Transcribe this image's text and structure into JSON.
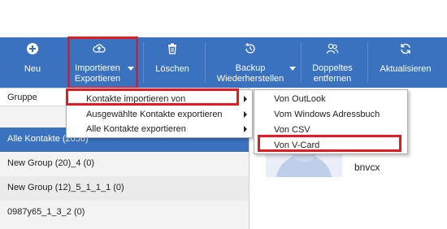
{
  "toolbar": {
    "buttons": [
      {
        "id": "neu",
        "label": "Neu",
        "icon": "plus-circle-icon"
      },
      {
        "id": "import",
        "label_line1": "Importieren",
        "label_line2": "Exportieren",
        "icon": "cloud-upload-icon"
      },
      {
        "id": "delete",
        "label": "Löschen",
        "icon": "trash-icon"
      },
      {
        "id": "backup",
        "label_line1": "Backup",
        "label_line2": "Wiederherstellen",
        "icon": "history-icon"
      },
      {
        "id": "dup",
        "label_line1": "Doppeltes",
        "label_line2": "entfernen",
        "icon": "users-icon"
      },
      {
        "id": "refresh",
        "label": "Aktualisieren",
        "icon": "refresh-icon"
      }
    ]
  },
  "sidebar": {
    "header": "Gruppe",
    "groups": [
      {
        "label": "Alle Kontakte  (2056)",
        "selected": true
      },
      {
        "label": "New Group (20)_4  (0)",
        "selected": false
      },
      {
        "label": "New Group (12)_5_1_1_1  (0)",
        "selected": false
      },
      {
        "label": "0987y65_1_3_2  (0)",
        "selected": false
      }
    ]
  },
  "dropdown": {
    "items": [
      {
        "label": "Kontakte importieren von",
        "has_submenu": true
      },
      {
        "label": "Ausgewählte Kontakte exportieren",
        "has_submenu": true
      },
      {
        "label": "Alle Kontakte exportieren",
        "has_submenu": true
      }
    ]
  },
  "submenu": {
    "items": [
      {
        "label": "Von OutLook"
      },
      {
        "label": "Vom Windows Adressbuch"
      },
      {
        "label": "Von CSV"
      },
      {
        "label": "Von V-Card"
      }
    ]
  },
  "contact": {
    "name": "bnvcx"
  },
  "colors": {
    "toolbar": "#3a72c0",
    "highlight": "#e01b24",
    "selected_row": "#3a72c0"
  }
}
